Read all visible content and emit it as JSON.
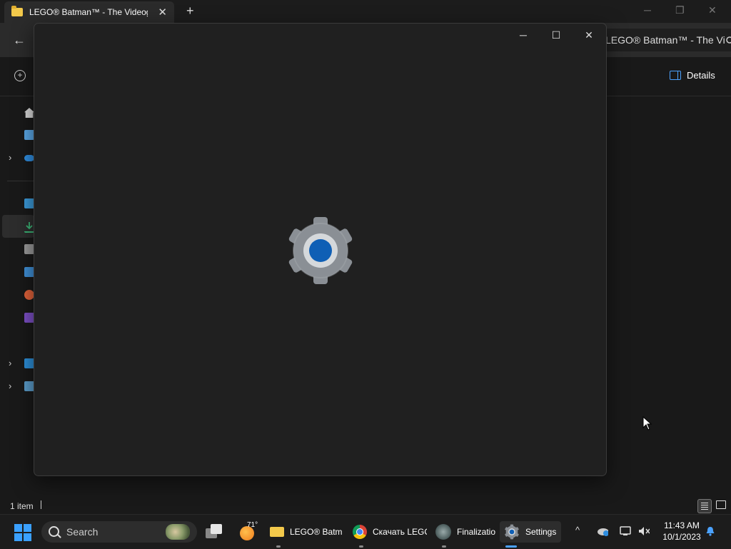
{
  "explorer": {
    "tab_title": "LEGO® Batman™ - The Videogame",
    "tab_close": "✕",
    "new_tab": "+",
    "window_controls": {
      "minimize": "─",
      "maximize": "❐",
      "close": "✕"
    },
    "back": "←",
    "address_text": "LEGO® Batman™ - The Vi",
    "new_button_glyph": "+",
    "details_label": "Details",
    "status_item_count": "1 item"
  },
  "settings": {
    "window_controls": {
      "minimize": "─",
      "maximize": "☐",
      "close": "✕"
    },
    "icon": "settings-gear-icon",
    "gear_color": "#8a8f95",
    "center_color": "#0f5fb5"
  },
  "taskbar": {
    "search_label": "Search",
    "weather_temp": "71°",
    "apps": [
      {
        "label": "LEGO® Batman™ - The Videogame",
        "icon": "folder-icon"
      },
      {
        "label": "Скачать LEGO",
        "icon": "chrome-icon"
      },
      {
        "label": "Finalization",
        "icon": "setup-icon"
      },
      {
        "label": "Settings",
        "icon": "settings-icon"
      }
    ],
    "tray_chevron": "^",
    "time": "11:43 AM",
    "date": "10/1/2023"
  },
  "colors": {
    "accent": "#4ba2ff",
    "folder": "#f3c94b",
    "window_bg": "#202020",
    "taskbar_bg": "#1c1c1c"
  }
}
